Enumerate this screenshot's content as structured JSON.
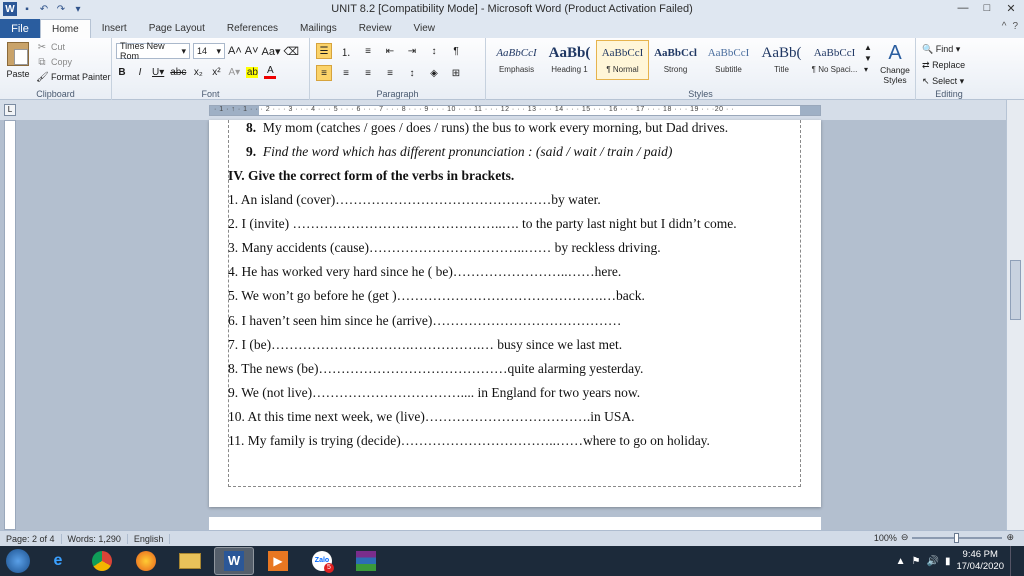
{
  "window": {
    "title": "UNIT 8.2 [Compatibility Mode]  -  Microsoft Word (Product Activation Failed)"
  },
  "ribbon_tabs": [
    "File",
    "Home",
    "Insert",
    "Page Layout",
    "References",
    "Mailings",
    "Review",
    "View"
  ],
  "clipboard": {
    "paste": "Paste",
    "cut": "Cut",
    "copy": "Copy",
    "format_painter": "Format Painter",
    "label": "Clipboard"
  },
  "font": {
    "name": "Times New Rom",
    "size": "14",
    "label": "Font"
  },
  "paragraph": {
    "label": "Paragraph"
  },
  "styles": {
    "items": [
      {
        "sample": "AaBbCcI",
        "name": "Emphasis"
      },
      {
        "sample": "AaBb(",
        "name": "Heading 1"
      },
      {
        "sample": "AaBbCcI",
        "name": "¶ Normal"
      },
      {
        "sample": "AaBbCcl",
        "name": "Strong"
      },
      {
        "sample": "AaBbCcI",
        "name": "Subtitle"
      },
      {
        "sample": "AaBb(",
        "name": "Title"
      },
      {
        "sample": "AaBbCcI",
        "name": "¶ No Spaci..."
      }
    ],
    "change_styles": "Change Styles",
    "label": "Styles"
  },
  "editing": {
    "find": "Find",
    "replace": "Replace",
    "select": "Select",
    "label": "Editing"
  },
  "ruler": {
    "text": "· 1 · ↑ · 1 · · · 2 · · · 3 · · · 4 · · · 5 · · · 6 · · · 7 · · · 8 · · · 9 · · · 10 · · · 11 · · · 12 · · · 13 · · · 14 · · · 15 · · · 16 · · · 17 · · · 18 · · · 19 · · ·20 · ·"
  },
  "document": {
    "q8_num": "8.",
    "q8_text": "My mom (catches / goes / does / runs) the bus to work every morning, but Dad drives.",
    "q9_num": "9.",
    "q9_text": "Find the word which has different pronunciation : (said / wait / train / paid)",
    "section_title": "IV. Give the correct form of the verbs in  brackets.",
    "exercises": [
      "1.    An island (cover)…………………………………………by water.",
      "2.    I (invite) ………………………………………..…. to the party last night but I didn’t come.",
      "3.    Many accidents (cause)……………………………..…… by reckless driving.",
      "4. He has worked very hard since he ( be)……………………..……here.",
      "5. We won’t go before he (get )……………………………………….…back.",
      "6. I haven’t seen him since he (arrive)……………………………………",
      "7. I (be)………………………….…………….… busy since we last met.",
      "8. The news (be)……………………………………quite alarming yesterday.",
      "9. We (not live)…………………………….... in England for two years now.",
      "10. At this time next week, we (live)……………………………….in USA.",
      "11. My family is trying (decide)……………………………..……where to go on holiday."
    ]
  },
  "statusbar": {
    "page": "Page: 2 of 4",
    "words": "Words: 1,290",
    "language": "English",
    "zoom": "100%"
  },
  "taskbar": {
    "apps": [
      "internet-explorer",
      "chrome",
      "firefox",
      "file-explorer",
      "word",
      "media-player",
      "zalo",
      "winrar"
    ],
    "zalo_badge": "5",
    "time": "9:46 PM",
    "date": "17/04/2020"
  }
}
